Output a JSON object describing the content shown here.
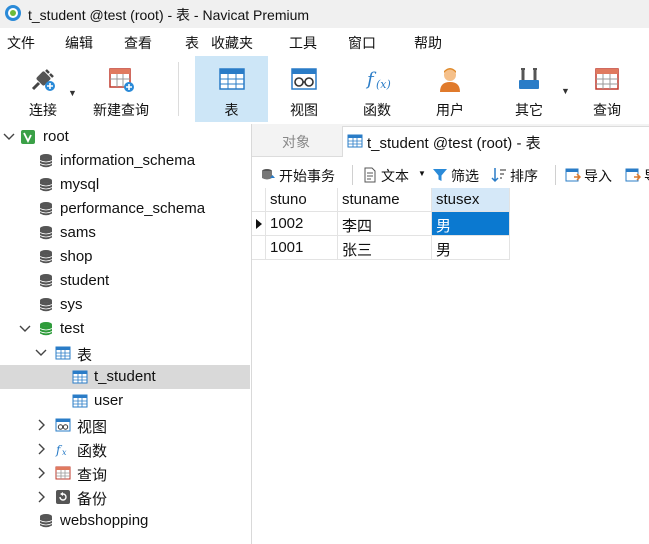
{
  "window": {
    "title": "t_student @test (root) - 表 - Navicat Premium"
  },
  "menu": [
    "文件",
    "编辑",
    "查看",
    "表",
    "收藏夹",
    "工具",
    "窗口",
    "帮助"
  ],
  "toolbar": {
    "connect": "连接",
    "new_query": "新建查询",
    "table": "表",
    "view": "视图",
    "function": "函数",
    "user": "用户",
    "other": "其它",
    "query": "查询"
  },
  "tree": {
    "root": "root",
    "databases": [
      "information_schema",
      "mysql",
      "performance_schema",
      "sams",
      "shop",
      "student",
      "sys"
    ],
    "test": {
      "label": "test",
      "tables_label": "表",
      "tables": [
        "t_student",
        "user"
      ],
      "view": "视图",
      "function": "函数",
      "query": "查询",
      "backup": "备份"
    },
    "last_db": "webshopping"
  },
  "tabs": {
    "objects": "对象",
    "active": "t_student @test (root) - 表"
  },
  "subtoolbar": {
    "begin_transaction": "开始事务",
    "text": "文本",
    "filter": "筛选",
    "sort": "排序",
    "import": "导入",
    "export": "导"
  },
  "grid": {
    "columns": [
      "stuno",
      "stuname",
      "stusex"
    ],
    "rows": [
      [
        "1002",
        "李四",
        "男"
      ],
      [
        "1001",
        "张三",
        "男"
      ]
    ]
  },
  "colors": {
    "accent": "#0b79d0",
    "active_tool": "#cde6f7",
    "selected_tree": "#d9d9d9",
    "db_icon": "#555555",
    "test_db_icon": "#2e9b3a"
  }
}
